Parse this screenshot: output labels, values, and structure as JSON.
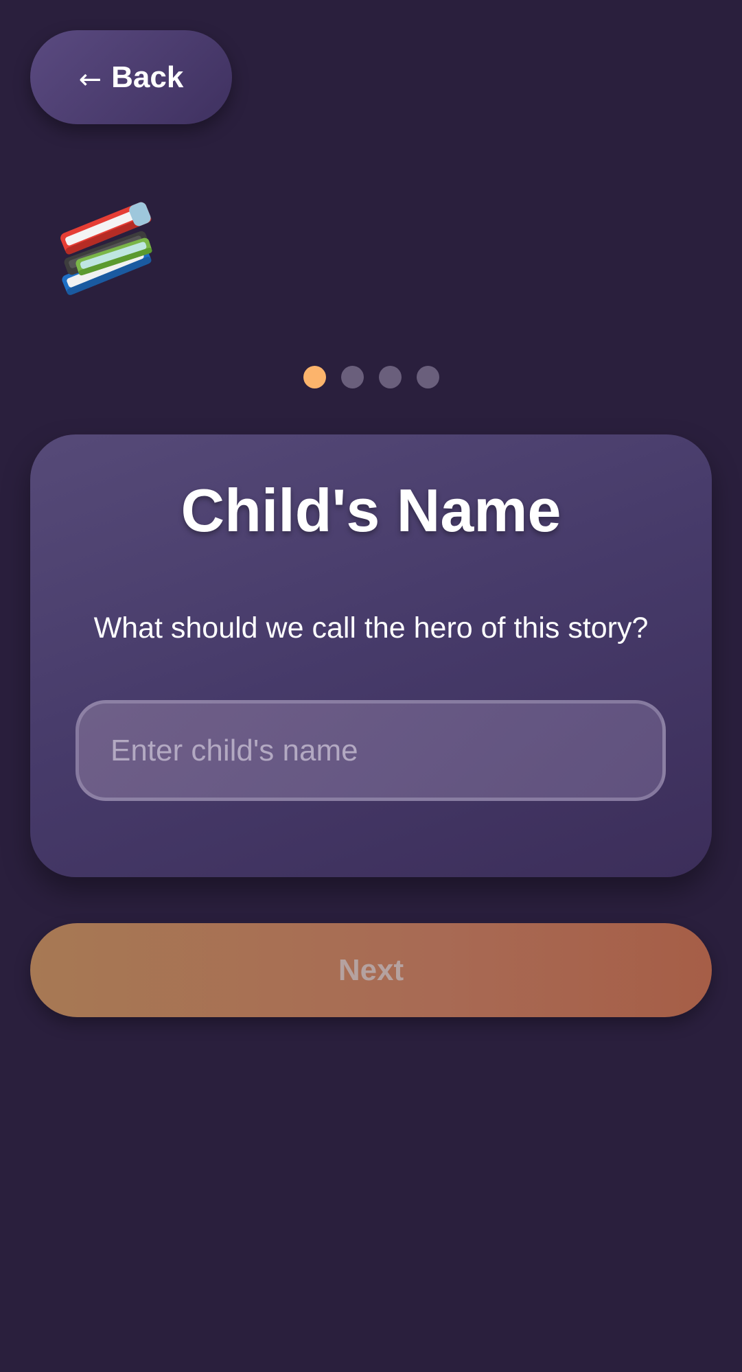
{
  "header": {
    "back_arrow": "←",
    "back_label": "Back"
  },
  "illustration": {
    "icon": "books-icon"
  },
  "progress": {
    "total_steps": 4,
    "current_step": 1,
    "active_color": "#fcb46c",
    "inactive_color": "#6a5f7c"
  },
  "card": {
    "title": "Child's Name",
    "subtitle": "What should we call the hero of this story?",
    "input": {
      "value": "",
      "placeholder": "Enter child's name"
    }
  },
  "footer": {
    "next_label": "Next"
  },
  "colors": {
    "background": "#2a1f3d",
    "card": "#4a3d6d",
    "accent": "#fcb46c",
    "button": "#a86a54"
  }
}
